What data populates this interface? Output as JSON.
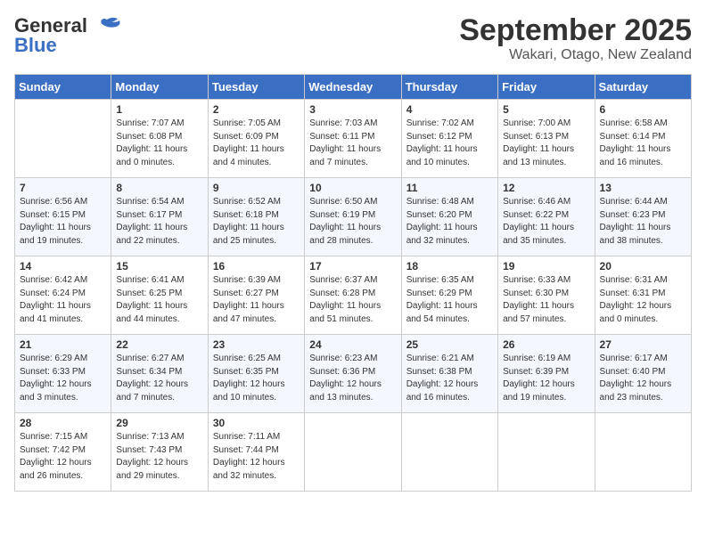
{
  "header": {
    "logo_line1": "General",
    "logo_line2": "Blue",
    "month": "September 2025",
    "location": "Wakari, Otago, New Zealand"
  },
  "days_of_week": [
    "Sunday",
    "Monday",
    "Tuesday",
    "Wednesday",
    "Thursday",
    "Friday",
    "Saturday"
  ],
  "weeks": [
    [
      {
        "day": "",
        "content": ""
      },
      {
        "day": "1",
        "content": "Sunrise: 7:07 AM\nSunset: 6:08 PM\nDaylight: 11 hours\nand 0 minutes."
      },
      {
        "day": "2",
        "content": "Sunrise: 7:05 AM\nSunset: 6:09 PM\nDaylight: 11 hours\nand 4 minutes."
      },
      {
        "day": "3",
        "content": "Sunrise: 7:03 AM\nSunset: 6:11 PM\nDaylight: 11 hours\nand 7 minutes."
      },
      {
        "day": "4",
        "content": "Sunrise: 7:02 AM\nSunset: 6:12 PM\nDaylight: 11 hours\nand 10 minutes."
      },
      {
        "day": "5",
        "content": "Sunrise: 7:00 AM\nSunset: 6:13 PM\nDaylight: 11 hours\nand 13 minutes."
      },
      {
        "day": "6",
        "content": "Sunrise: 6:58 AM\nSunset: 6:14 PM\nDaylight: 11 hours\nand 16 minutes."
      }
    ],
    [
      {
        "day": "7",
        "content": "Sunrise: 6:56 AM\nSunset: 6:15 PM\nDaylight: 11 hours\nand 19 minutes."
      },
      {
        "day": "8",
        "content": "Sunrise: 6:54 AM\nSunset: 6:17 PM\nDaylight: 11 hours\nand 22 minutes."
      },
      {
        "day": "9",
        "content": "Sunrise: 6:52 AM\nSunset: 6:18 PM\nDaylight: 11 hours\nand 25 minutes."
      },
      {
        "day": "10",
        "content": "Sunrise: 6:50 AM\nSunset: 6:19 PM\nDaylight: 11 hours\nand 28 minutes."
      },
      {
        "day": "11",
        "content": "Sunrise: 6:48 AM\nSunset: 6:20 PM\nDaylight: 11 hours\nand 32 minutes."
      },
      {
        "day": "12",
        "content": "Sunrise: 6:46 AM\nSunset: 6:22 PM\nDaylight: 11 hours\nand 35 minutes."
      },
      {
        "day": "13",
        "content": "Sunrise: 6:44 AM\nSunset: 6:23 PM\nDaylight: 11 hours\nand 38 minutes."
      }
    ],
    [
      {
        "day": "14",
        "content": "Sunrise: 6:42 AM\nSunset: 6:24 PM\nDaylight: 11 hours\nand 41 minutes."
      },
      {
        "day": "15",
        "content": "Sunrise: 6:41 AM\nSunset: 6:25 PM\nDaylight: 11 hours\nand 44 minutes."
      },
      {
        "day": "16",
        "content": "Sunrise: 6:39 AM\nSunset: 6:27 PM\nDaylight: 11 hours\nand 47 minutes."
      },
      {
        "day": "17",
        "content": "Sunrise: 6:37 AM\nSunset: 6:28 PM\nDaylight: 11 hours\nand 51 minutes."
      },
      {
        "day": "18",
        "content": "Sunrise: 6:35 AM\nSunset: 6:29 PM\nDaylight: 11 hours\nand 54 minutes."
      },
      {
        "day": "19",
        "content": "Sunrise: 6:33 AM\nSunset: 6:30 PM\nDaylight: 11 hours\nand 57 minutes."
      },
      {
        "day": "20",
        "content": "Sunrise: 6:31 AM\nSunset: 6:31 PM\nDaylight: 12 hours\nand 0 minutes."
      }
    ],
    [
      {
        "day": "21",
        "content": "Sunrise: 6:29 AM\nSunset: 6:33 PM\nDaylight: 12 hours\nand 3 minutes."
      },
      {
        "day": "22",
        "content": "Sunrise: 6:27 AM\nSunset: 6:34 PM\nDaylight: 12 hours\nand 7 minutes."
      },
      {
        "day": "23",
        "content": "Sunrise: 6:25 AM\nSunset: 6:35 PM\nDaylight: 12 hours\nand 10 minutes."
      },
      {
        "day": "24",
        "content": "Sunrise: 6:23 AM\nSunset: 6:36 PM\nDaylight: 12 hours\nand 13 minutes."
      },
      {
        "day": "25",
        "content": "Sunrise: 6:21 AM\nSunset: 6:38 PM\nDaylight: 12 hours\nand 16 minutes."
      },
      {
        "day": "26",
        "content": "Sunrise: 6:19 AM\nSunset: 6:39 PM\nDaylight: 12 hours\nand 19 minutes."
      },
      {
        "day": "27",
        "content": "Sunrise: 6:17 AM\nSunset: 6:40 PM\nDaylight: 12 hours\nand 23 minutes."
      }
    ],
    [
      {
        "day": "28",
        "content": "Sunrise: 7:15 AM\nSunset: 7:42 PM\nDaylight: 12 hours\nand 26 minutes."
      },
      {
        "day": "29",
        "content": "Sunrise: 7:13 AM\nSunset: 7:43 PM\nDaylight: 12 hours\nand 29 minutes."
      },
      {
        "day": "30",
        "content": "Sunrise: 7:11 AM\nSunset: 7:44 PM\nDaylight: 12 hours\nand 32 minutes."
      },
      {
        "day": "",
        "content": ""
      },
      {
        "day": "",
        "content": ""
      },
      {
        "day": "",
        "content": ""
      },
      {
        "day": "",
        "content": ""
      }
    ]
  ]
}
